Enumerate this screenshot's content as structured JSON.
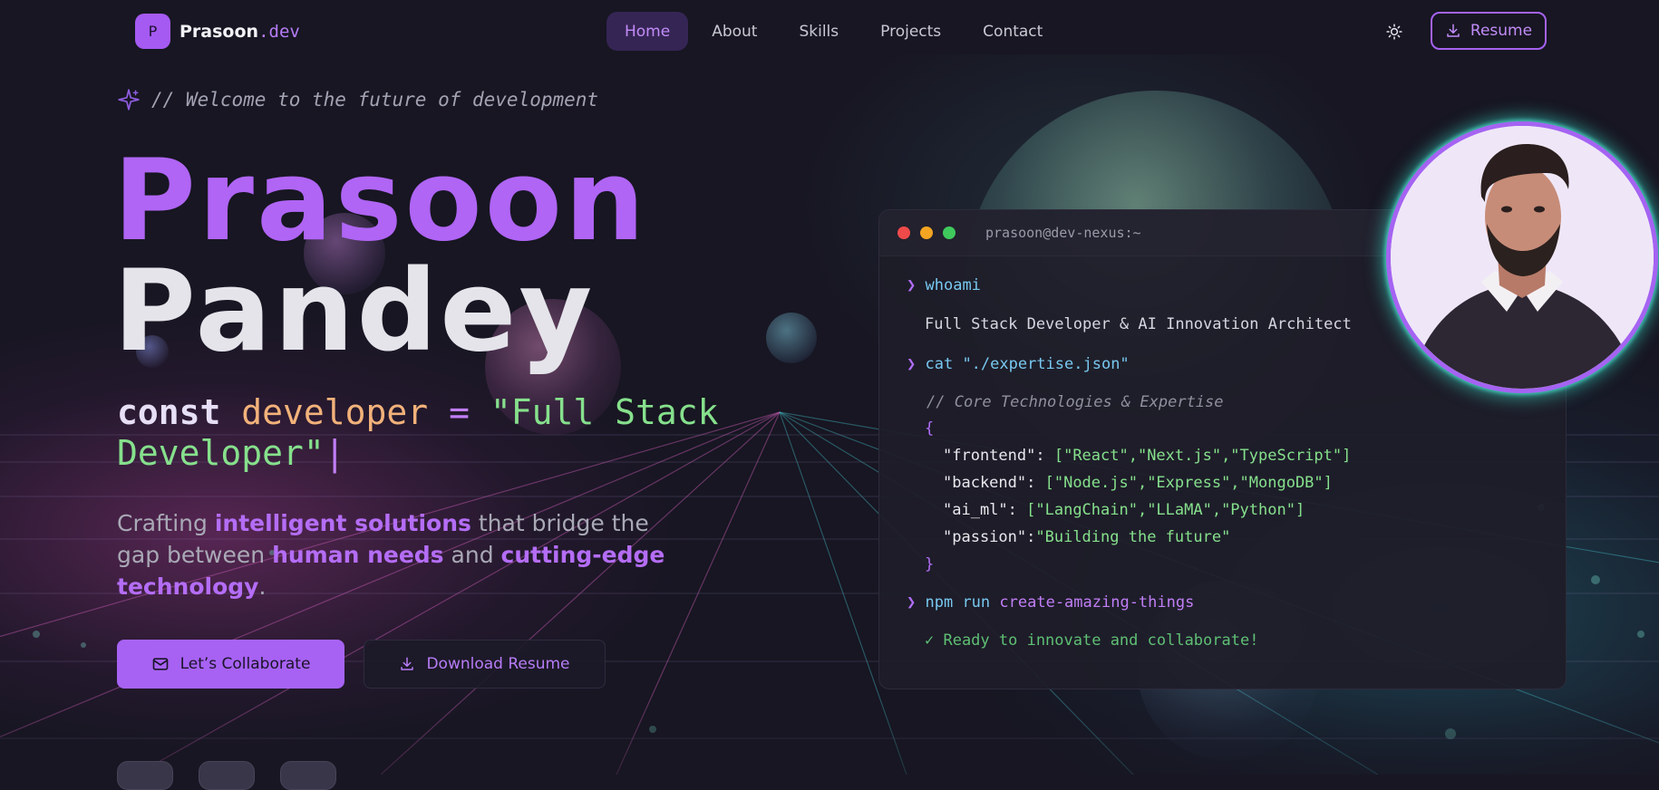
{
  "nav": {
    "logo_letter": "P",
    "logo_name": "Prasoon",
    "logo_ext": ".dev",
    "links": [
      {
        "label": "Home",
        "active": true
      },
      {
        "label": "About",
        "active": false
      },
      {
        "label": "Skills",
        "active": false
      },
      {
        "label": "Projects",
        "active": false
      },
      {
        "label": "Contact",
        "active": false
      }
    ],
    "theme_icon": "sun-icon",
    "resume_label": "Resume"
  },
  "hero": {
    "welcome": "// Welcome to the future of development",
    "name_first": "Prasoon",
    "name_last": "Pandey",
    "code": {
      "keyword": "const",
      "variable": "developer",
      "operator": "=",
      "string": "\"Full Stack Developer\"",
      "cursor": "|"
    },
    "tagline": {
      "t1": "Crafting ",
      "h1": "intelligent solutions",
      "t2": " that bridge the gap between ",
      "h2": "human needs",
      "t3": " and ",
      "h3": "cutting-edge technology",
      "t4": "."
    },
    "primary_button": "Let’s Collaborate",
    "secondary_button": "Download Resume"
  },
  "terminal": {
    "title": "prasoon@dev-nexus:~",
    "prompt": "❯",
    "cmd1": "whoami",
    "out1": "Full Stack Developer & AI Innovation Architect",
    "cmd2": "cat \"./expertise.json\"",
    "comment": "// Core Technologies & Expertise",
    "open_brace": "{",
    "close_brace": "}",
    "json": {
      "frontend_key": "\"frontend\"",
      "frontend_val": "[\"React\",\"Next.js\",\"TypeScript\"]",
      "backend_key": "\"backend\"",
      "backend_val": "[\"Node.js\",\"Express\",\"MongoDB\"]",
      "ai_key": "\"ai_ml\"",
      "ai_val": "[\"LangChain\",\"LLaMA\",\"Python\"]",
      "passion_key": "\"passion\"",
      "passion_val": "\"Building the future\""
    },
    "cmd3_a": "npm run",
    "cmd3_b": "create-amazing-things",
    "ready": "✓ Ready to innovate and collaborate!"
  },
  "colors": {
    "accent": "#a55af2",
    "background": "#171622",
    "terminal_green": "#86e08c",
    "avatar_glow": "#3cdcc8"
  }
}
